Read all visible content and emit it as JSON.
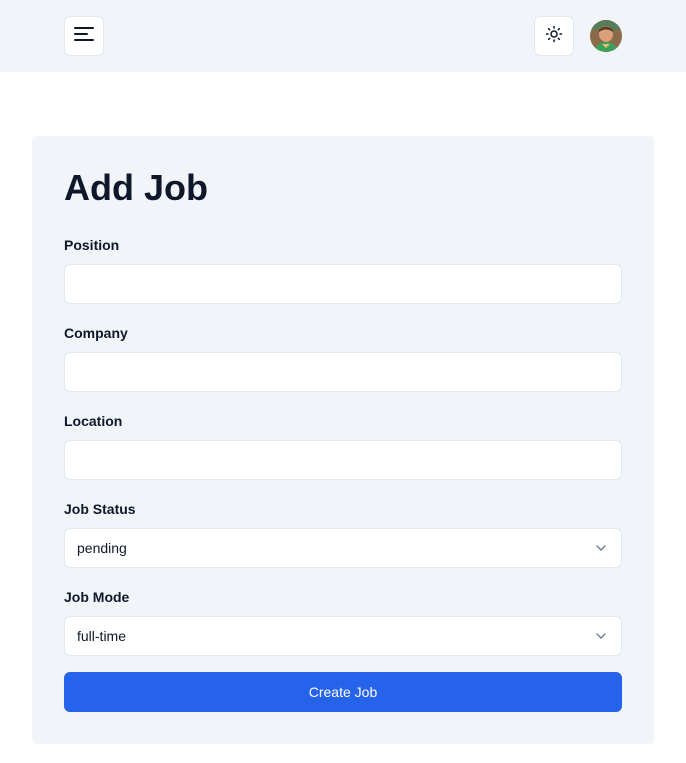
{
  "form": {
    "title": "Add Job",
    "fields": [
      {
        "label": "Position",
        "value": ""
      },
      {
        "label": "Company",
        "value": ""
      },
      {
        "label": "Location",
        "value": ""
      }
    ],
    "selects": [
      {
        "label": "Job Status",
        "value": "pending"
      },
      {
        "label": "Job Mode",
        "value": "full-time"
      }
    ],
    "submit_label": "Create Job"
  },
  "colors": {
    "accent": "#2563eb",
    "panel": "#f1f5f9",
    "text": "#0f172a"
  },
  "icons": {
    "menu": "menu-icon",
    "theme": "sun-icon",
    "select": "chevron-down-icon"
  }
}
